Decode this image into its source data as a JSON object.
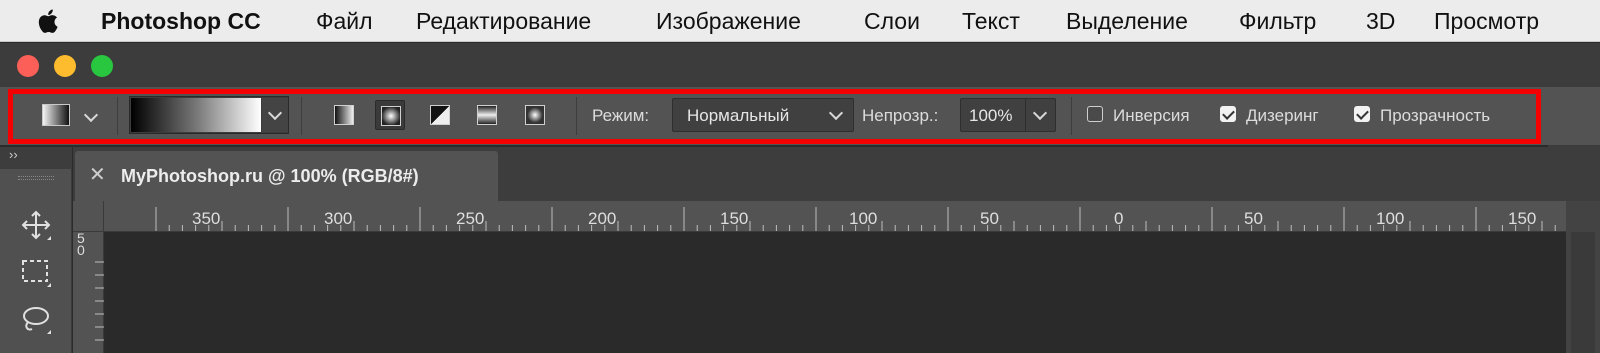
{
  "menubar": {
    "app_name": "Photoshop CC",
    "items": [
      "Файл",
      "Редактирование",
      "Изображение",
      "Слои",
      "Текст",
      "Выделение",
      "Фильтр",
      "3D",
      "Просмотр"
    ]
  },
  "window_controls": [
    "close",
    "minimize",
    "zoom"
  ],
  "options_bar": {
    "tool_preset_icon": "gradient-tool-preset-icon",
    "gradient_picker_icon": "gradient-preview",
    "gradient_types": [
      {
        "name": "linear-gradient-icon",
        "active": false
      },
      {
        "name": "radial-gradient-icon",
        "active": true
      },
      {
        "name": "angle-gradient-icon",
        "active": false
      },
      {
        "name": "reflected-gradient-icon",
        "active": false
      },
      {
        "name": "diamond-gradient-icon",
        "active": false
      }
    ],
    "mode_label": "Режим:",
    "mode_value": "Нормальный",
    "opacity_label": "Непрозр.:",
    "opacity_value": "100%",
    "checkboxes": [
      {
        "label": "Инверсия",
        "checked": false
      },
      {
        "label": "Дизеринг",
        "checked": true
      },
      {
        "label": "Прозрачность",
        "checked": true
      }
    ],
    "highlight_color": "#f40000"
  },
  "tools": [
    "move-tool-icon",
    "marquee-tool-icon",
    "lasso-tool-icon"
  ],
  "document": {
    "tab_title": "MyPhotoshop.ru @ 100% (RGB/8#)"
  },
  "ruler": {
    "horizontal_labels": [
      "350",
      "300",
      "250",
      "200",
      "150",
      "100",
      "50",
      "0",
      "50",
      "100",
      "150"
    ],
    "vertical_labels": [
      "5",
      "0"
    ]
  }
}
